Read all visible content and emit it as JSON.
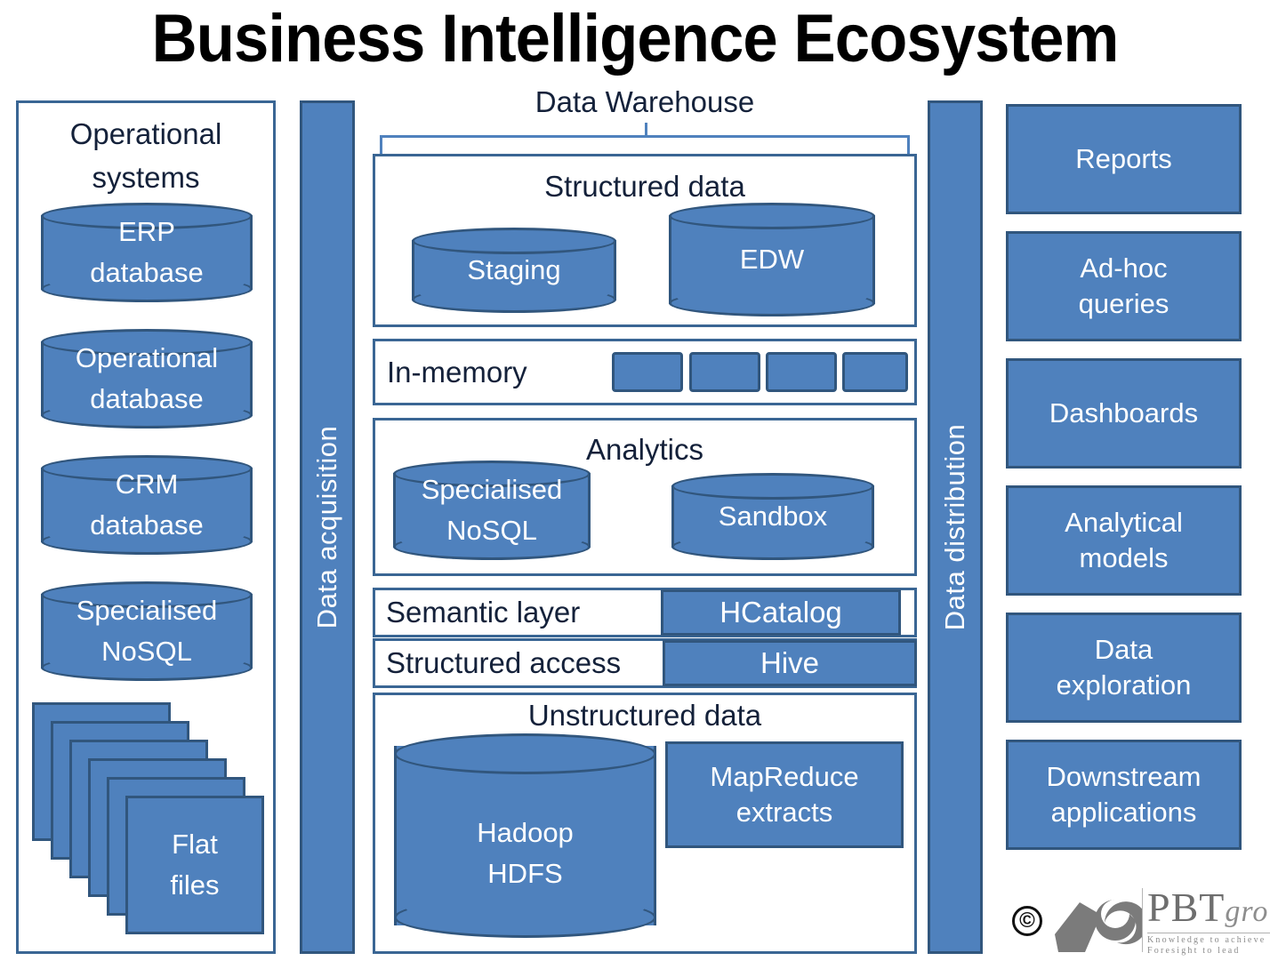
{
  "title": "Business Intelligence Ecosystem",
  "colors": {
    "fill": "#4f81bd",
    "stroke": "#31567d",
    "panel_border": "#3a6694",
    "text_dark": "#14213a",
    "text_light": "#ffffff"
  },
  "left_column": {
    "heading_line1": "Operational",
    "heading_line2": "systems",
    "databases": [
      {
        "line1": "ERP",
        "line2": "database"
      },
      {
        "line1": "Operational",
        "line2": "database"
      },
      {
        "line1": "CRM",
        "line2": "database"
      },
      {
        "line1": "Specialised",
        "line2": "NoSQL"
      }
    ],
    "flat_files": {
      "line1": "Flat",
      "line2": "files",
      "card_count": 6
    }
  },
  "acquisition_bar": {
    "label": "Data acquisition"
  },
  "warehouse": {
    "bracket_label": "Data Warehouse",
    "structured": {
      "title": "Structured data",
      "cylinders": [
        {
          "label": "Staging"
        },
        {
          "label": "EDW"
        }
      ]
    },
    "in_memory": {
      "label": "In-memory",
      "chip_count": 4
    },
    "analytics": {
      "title": "Analytics",
      "cylinders": [
        {
          "line1": "Specialised",
          "line2": "NoSQL"
        },
        {
          "line1": "Sandbox",
          "line2": ""
        }
      ]
    },
    "semantic_layer": {
      "label": "Semantic layer",
      "tool": "HCatalog"
    },
    "structured_access": {
      "label": "Structured access",
      "tool": "Hive"
    },
    "unstructured": {
      "title": "Unstructured data",
      "cylinder": {
        "line1": "Hadoop",
        "line2": "HDFS"
      },
      "box": {
        "line1": "MapReduce",
        "line2": "extracts"
      }
    }
  },
  "distribution_bar": {
    "label": "Data distribution"
  },
  "right_column": {
    "items": [
      {
        "line1": "Reports",
        "line2": ""
      },
      {
        "line1": "Ad-hoc",
        "line2": "queries"
      },
      {
        "line1": "Dashboards",
        "line2": ""
      },
      {
        "line1": "Analytical",
        "line2": "models"
      },
      {
        "line1": "Data",
        "line2": "exploration"
      },
      {
        "line1": "Downstream",
        "line2": "applications"
      }
    ]
  },
  "logo": {
    "copyright": "©",
    "wordmark": "PBT",
    "group": "group",
    "tagline_line1": "Knowledge to achieve",
    "tagline_line2": "Foresight to lead"
  }
}
